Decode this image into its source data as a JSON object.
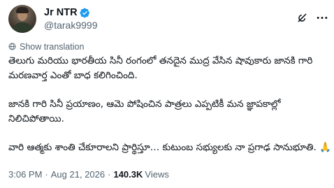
{
  "author": {
    "display_name": "Jr NTR",
    "handle": "@tarak9999",
    "verified": true,
    "verified_color": "#1d9bf0"
  },
  "actions": {
    "grok_icon": "grok-icon",
    "more_icon": "more-icon"
  },
  "translate": {
    "label": "Show translation"
  },
  "tweet": {
    "paragraphs": [
      "తెలుగు మరియు భారతీయ సినీ రంగంలో తనదైన ముద్ర వేసిన షావుకారు జానకి గారి మరణవార్త ఎంతో బాధ కలిగించింది.",
      "జానకి గారి సినీ ప్రయాణం, ఆమె పోషించిన పాత్రలు ఎప్పటికీ మన జ్ఞాపకాల్లో నిలిచిపోతాయి.",
      "వారి ఆత్మకు శాంతి చేకూరాలని ప్రార్థిస్తూ… కుటుంబ సభ్యులకు నా ప్రగాఢ సానుభూతి. 🙏"
    ]
  },
  "meta": {
    "time": "3:06 PM",
    "date": "Aug 21, 2026",
    "views_count": "140.3K",
    "views_label": "Views"
  }
}
